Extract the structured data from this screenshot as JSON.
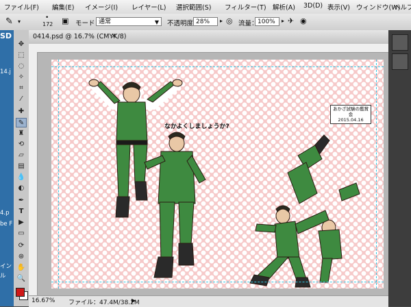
{
  "menu": [
    "ファイル(F)",
    "編集(E)",
    "イメージ(I)",
    "レイヤー(L)",
    "選択範囲(S)",
    "フィルター(T)",
    "解析(A)",
    "3D(D)",
    "表示(V)",
    "ウィンドウ(W)",
    "ヘルプ(H)"
  ],
  "options": {
    "brush_size": "172",
    "mode_label": "モード：",
    "mode_value": "通常",
    "opacity_label": "不透明度：",
    "opacity_value": "28%",
    "flow_label": "流量：",
    "flow_value": "100%"
  },
  "document": {
    "tab_title": "0414.psd @ 16.7% (CMYK/8)",
    "close": "×"
  },
  "canvas": {
    "speech_bubble": "なかよくしましょうか?",
    "signature_line1": "あかざ試験の鑑賞会",
    "signature_line2": "2015.04.16"
  },
  "status": {
    "zoom": "16.67%",
    "file_info": "ファイル：47.4M/38.2M"
  },
  "left_strip": [
    "SD",
    "14.j",
    "4.p",
    "be F",
    "イン",
    "ル"
  ],
  "colors": {
    "foreground": "#d01818",
    "background": "#ffffff"
  }
}
